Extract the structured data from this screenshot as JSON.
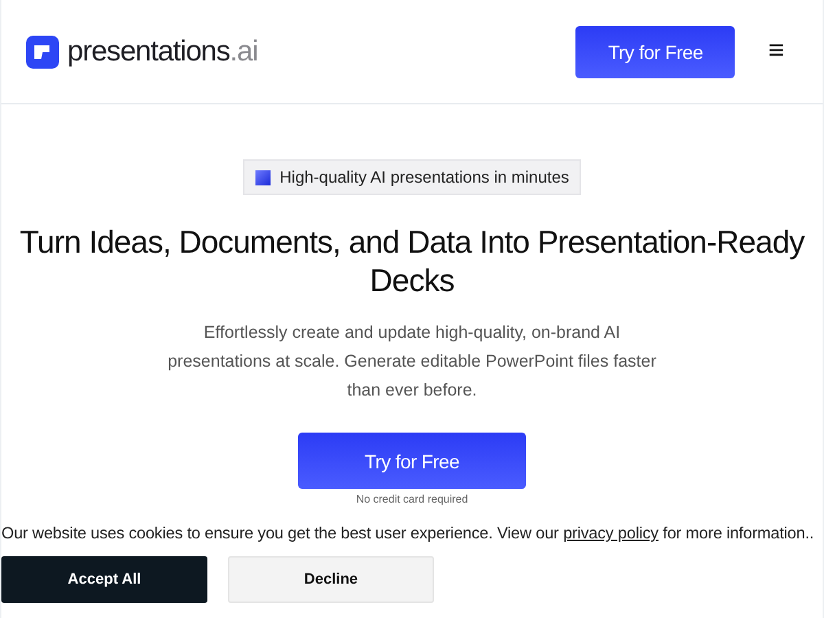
{
  "header": {
    "logo": {
      "name": "presentations",
      "suffix": ".ai"
    },
    "cta": "Try for Free",
    "menu": "≡"
  },
  "hero": {
    "badge": "High-quality AI presentations in minutes",
    "title": "Turn Ideas, Documents, and Data Into Presentation-Ready Decks",
    "subtitle": "Effortlessly create and update high-quality, on-brand AI presentations at scale. Generate editable PowerPoint files faster than ever before.",
    "cta": "Try for Free",
    "note": "No credit card required"
  },
  "cookie_banner": {
    "text": "Our website uses cookies to ensure you get the best user experience. View our",
    "link": "privacy policy",
    "text_after": "for more information..",
    "buttons": [
      {
        "label": "Accept All",
        "kind": "primary"
      },
      {
        "label": "Decline",
        "kind": "secondary"
      }
    ]
  }
}
